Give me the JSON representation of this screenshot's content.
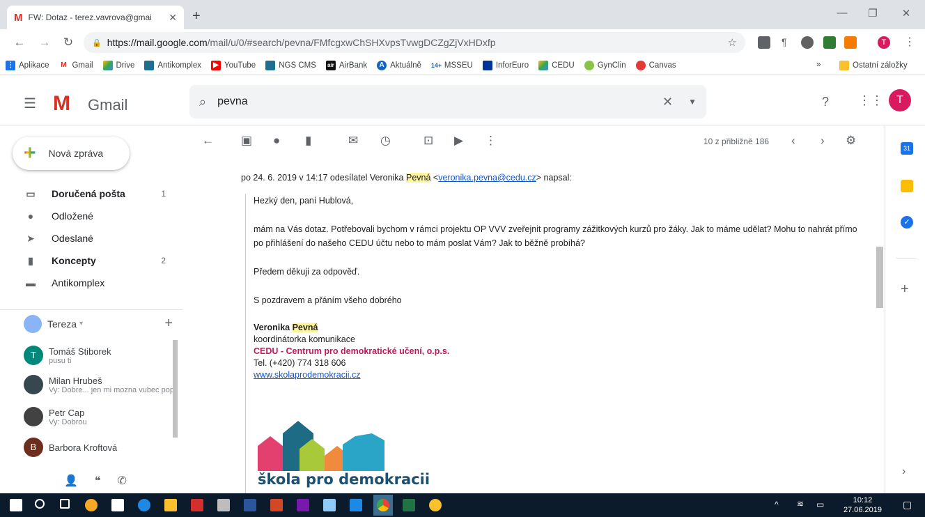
{
  "browser": {
    "tab_title": "FW: Dotaz - terez.vavrova@gmai",
    "url_host": "https://mail.google.com",
    "url_path": "/mail/u/0/#search/pevna/FMfcgxwChSHXvpsTvwgDCZgZjVxHDxfp"
  },
  "bookmarks": [
    "Aplikace",
    "Gmail",
    "Drive",
    "Antikomplex",
    "YouTube",
    "NGS CMS",
    "AirBank",
    "Aktuálně",
    "MSSEU",
    "InforEuro",
    "CEDU",
    "GynClin",
    "Canvas"
  ],
  "bookmarks_more": "»",
  "bookmarks_other": "Ostatní záložky",
  "gmail": {
    "app_name": "Gmail",
    "search_value": "pevna",
    "account_initial": "T"
  },
  "compose_label": "Nová zpráva",
  "nav": [
    {
      "label": "Doručená pošta",
      "count": "1",
      "bold": true,
      "icon": "inbox-icon"
    },
    {
      "label": "Odložené",
      "count": "",
      "bold": false,
      "icon": "clock-icon"
    },
    {
      "label": "Odeslané",
      "count": "",
      "bold": false,
      "icon": "send-icon"
    },
    {
      "label": "Koncepty",
      "count": "2",
      "bold": true,
      "icon": "draft-icon"
    },
    {
      "label": "Antikomplex",
      "count": "",
      "bold": false,
      "icon": "label-icon"
    }
  ],
  "hangouts": {
    "user": "Tereza",
    "contacts": [
      {
        "name": "Tomáš Stiborek",
        "sub": "pusu ti",
        "initial": "T",
        "color": "#00897b"
      },
      {
        "name": "Milan Hrubeš",
        "sub": "Vy: Dobre... jen mi mozna vubec pop",
        "initial": "",
        "color": "#37474f"
      },
      {
        "name": "Petr Cap",
        "sub": "Vy: Dobrou",
        "initial": "",
        "color": "#424242"
      },
      {
        "name": "Barbora Kroftová",
        "sub": "",
        "initial": "B",
        "color": "#6d2e1d"
      }
    ]
  },
  "pager": "10 z přibližně 186",
  "email": {
    "header_prefix": "po 24. 6. 2019 v 14:17 odesílatel Veronika ",
    "header_hl": "Pevná",
    "header_lt": " <",
    "header_email": "veronika.pevna@cedu.cz",
    "header_suffix": "> napsal:",
    "greeting": "Hezký den, paní Hublová,",
    "body": "mám na Vás dotaz. Potřebovali bychom v rámci projektu OP VVV zveřejnit programy zážitkových kurzů pro žáky. Jak to máme udělat? Mohu to nahrát přímo po přihlášení do našeho CEDU účtu nebo to mám poslat Vám? Jak to běžně probíhá?",
    "thanks": "Předem děkuji za odpověď.",
    "closing": "S pozdravem a přáním všeho dobrého",
    "sig_first": "Veronika ",
    "sig_last": "Pevná",
    "sig_role": "koordinátorka komunikace",
    "sig_org": "CEDU - Centrum pro demokratické učení, o.p.s.",
    "sig_tel": "Tel. (+420) 774 318 606",
    "sig_web": "www.skolaprodemokracii.cz",
    "logo_text": "škola pro demokracii"
  },
  "taskbar": {
    "time": "10:12",
    "date": "27.06.2019"
  }
}
